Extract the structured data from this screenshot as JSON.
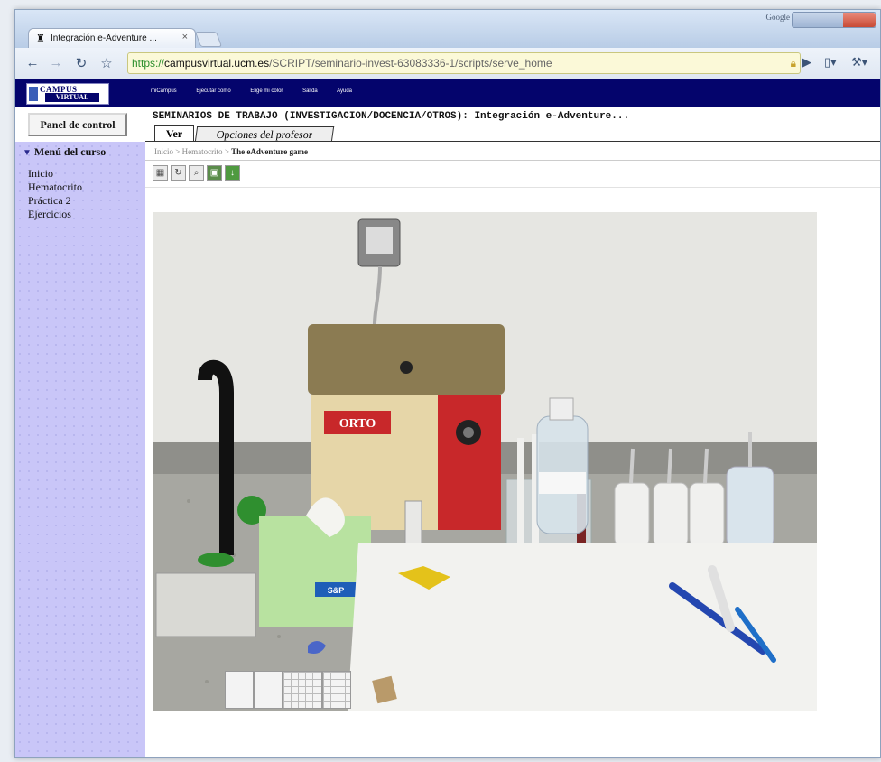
{
  "browser": {
    "tab_title": "Integración e-Adventure ...",
    "google_label": "Google",
    "url_scheme": "https://",
    "url_host": "campusvirtual.ucm.es",
    "url_path": "/SCRIPT/seminario-invest-63083336-1/scripts/serve_home"
  },
  "site": {
    "logo_line1": "CAMPUS",
    "logo_line2": "VIRTUAL",
    "nav": [
      "miCampus",
      "Ejecutar como",
      "Elige mi color",
      "Salida",
      "Ayuda"
    ]
  },
  "panel_button": "Panel de control",
  "course_title": "SEMINARIOS DE TRABAJO (INVESTIGACION/DOCENCIA/OTROS): Integración e-Adventure...",
  "tabs": {
    "ver": "Ver",
    "profesor": "Opciones del profesor"
  },
  "sidebar": {
    "title": "Menú del curso",
    "items": [
      "Inicio",
      "Hematocrito",
      "Práctica 2",
      "Ejercicios"
    ]
  },
  "breadcrumb": {
    "root": "Inicio",
    "section": "Hematocrito",
    "current": "The eAdventure game"
  },
  "scene": {
    "device_label": "ORTO",
    "box_label": "S&P"
  },
  "colors": {
    "header": "#04046c",
    "sidebar": "#c9c6f8",
    "device_red": "#c8282a"
  }
}
